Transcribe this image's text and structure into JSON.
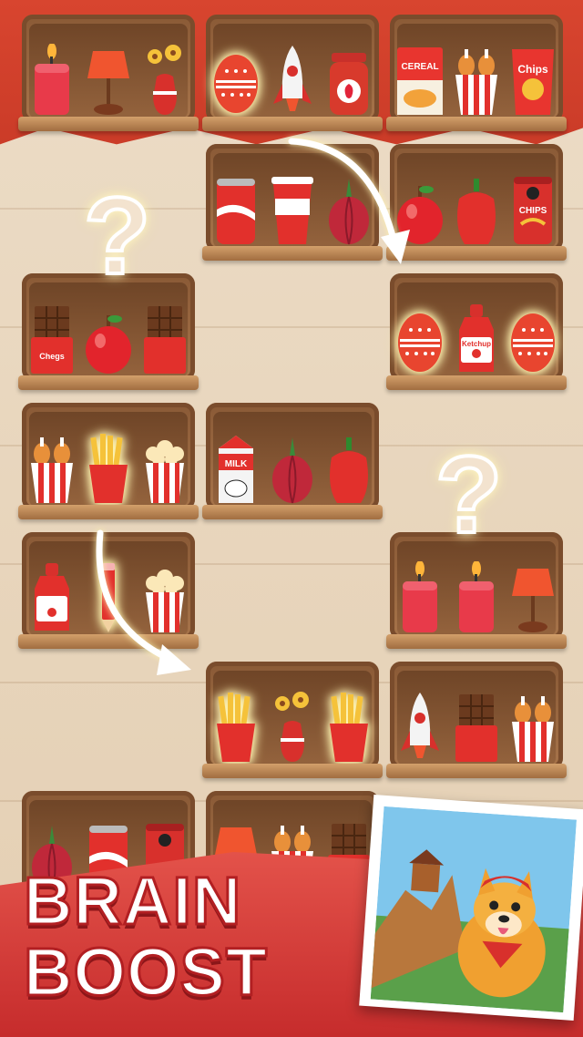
{
  "banner": {
    "line1": "BRAIN",
    "line2": "BOOST"
  },
  "hints": {
    "mark": "?"
  },
  "labels": {
    "cereal": "CEREAL",
    "chips_bag": "Chips",
    "chips_can": "CHIPS",
    "chocolate": "Chegs",
    "ketchup": "Ketchup",
    "milk": "MILK"
  },
  "shelves": [
    {
      "name": "shelf-1",
      "items": [
        "candle",
        "lamp",
        "flower-vase"
      ]
    },
    {
      "name": "shelf-2",
      "items": [
        "easter-egg",
        "rocket",
        "strawberry-jam"
      ]
    },
    {
      "name": "shelf-3",
      "items": [
        "cereal-box",
        "chicken-bucket",
        "chips-bag"
      ]
    },
    {
      "name": "shelf-4",
      "items": [
        "soda-can",
        "paper-cup",
        "onion"
      ]
    },
    {
      "name": "shelf-5",
      "items": [
        "apple",
        "bell-pepper",
        "chips-can"
      ]
    },
    {
      "name": "shelf-6",
      "items": [
        "chocolate-bar",
        "apple",
        "chocolate-bar"
      ]
    },
    {
      "name": "shelf-7",
      "items": [
        "easter-egg",
        "ketchup-bottle",
        "easter-egg"
      ]
    },
    {
      "name": "shelf-8",
      "items": [
        "chicken-bucket",
        "french-fries",
        "popcorn"
      ]
    },
    {
      "name": "shelf-9",
      "items": [
        "milk-carton",
        "onion",
        "bell-pepper"
      ]
    },
    {
      "name": "shelf-10",
      "items": [
        "ketchup-bottle",
        "pencil",
        "popcorn"
      ]
    },
    {
      "name": "shelf-11",
      "items": [
        "candle",
        "candle",
        "lamp"
      ]
    },
    {
      "name": "shelf-12",
      "items": [
        "french-fries",
        "flower-vase",
        "french-fries"
      ]
    },
    {
      "name": "shelf-13",
      "items": [
        "rocket",
        "chocolate-bar",
        "chicken-bucket"
      ]
    },
    {
      "name": "shelf-14",
      "items": [
        "onion",
        "soda-can",
        "chips-can"
      ]
    },
    {
      "name": "shelf-15",
      "items": [
        "lamp",
        "chicken-bucket",
        "chocolate-bar"
      ]
    }
  ],
  "colors": {
    "accent": "#d8452f",
    "shelf": "#8a5a36",
    "banner": "#d63a37",
    "wall": "#e9d6bd"
  }
}
